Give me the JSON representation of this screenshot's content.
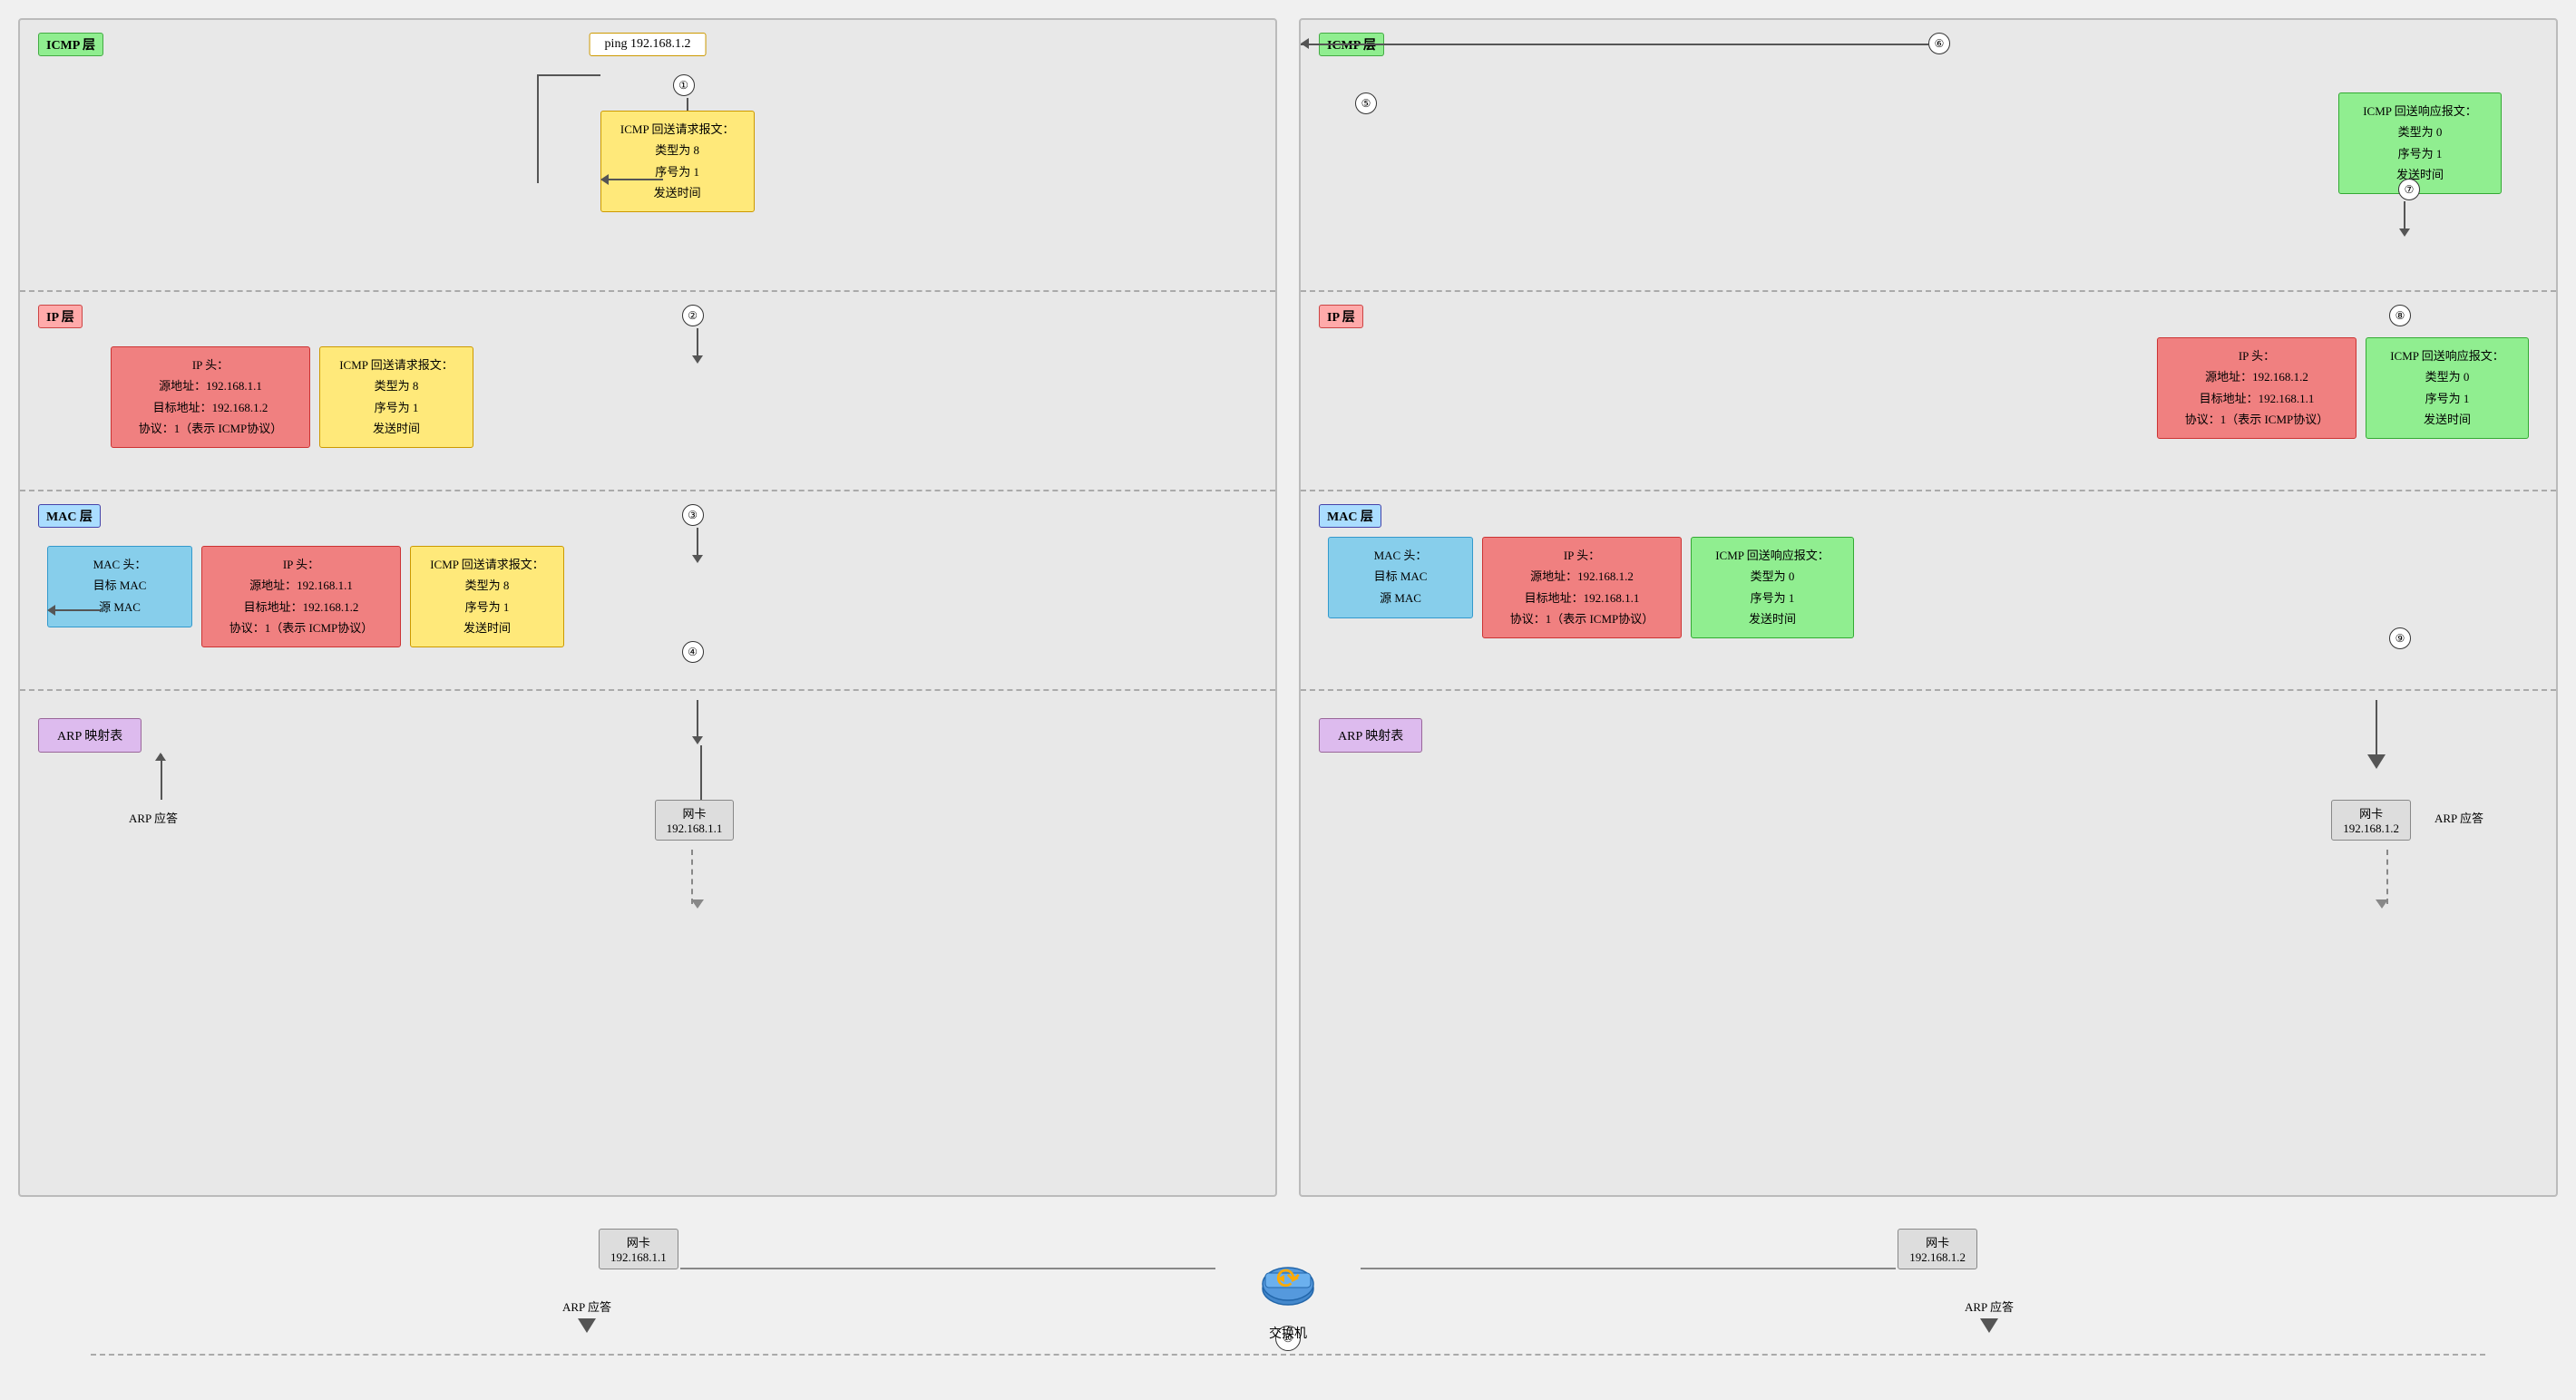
{
  "left_panel": {
    "ping_cmd": "ping 192.168.1.2",
    "icmp_layer_label": "ICMP 层",
    "ip_layer_label": "IP 层",
    "mac_layer_label": "MAC 层",
    "icmp_request_box": {
      "title": "ICMP 回送请求报文：",
      "line1": "类型为 8",
      "line2": "序号为 1",
      "line3": "发送时间"
    },
    "ip_header_box": {
      "title": "IP 头：",
      "line1": "源地址：192.168.1.1",
      "line2": "目标地址：192.168.1.2",
      "line3": "协议：1（表示 ICMP协议）"
    },
    "icmp_req_copy": {
      "title": "ICMP 回送请求报文：",
      "line1": "类型为 8",
      "line2": "序号为 1",
      "line3": "发送时间"
    },
    "mac_header_box": {
      "title": "MAC 头：",
      "line1": "目标 MAC",
      "line2": "源 MAC"
    },
    "ip_header_copy": {
      "title": "IP 头：",
      "line1": "源地址：192.168.1.1",
      "line2": "目标地址：192.168.1.2",
      "line3": "协议：1（表示 ICMP协议）"
    },
    "icmp_req_copy2": {
      "title": "ICMP 回送请求报文：",
      "line1": "类型为 8",
      "line2": "序号为 1",
      "line3": "发送时间"
    },
    "arp_table": "ARP 映射表",
    "arp_reply": "ARP 应答",
    "nic": "网卡\n192.168.1.1",
    "steps": {
      "s1": "①",
      "s2": "②",
      "s3": "③",
      "s4": "④"
    }
  },
  "right_panel": {
    "icmp_layer_label": "ICMP 层",
    "ip_layer_label": "IP 层",
    "mac_layer_label": "MAC 层",
    "icmp_response_box": {
      "title": "ICMP 回送响应报文：",
      "line1": "类型为 0",
      "line2": "序号为 1",
      "line3": "发送时间"
    },
    "ip_header_box": {
      "title": "IP 头：",
      "line1": "源地址：192.168.1.2",
      "line2": "目标地址：192.168.1.1",
      "line3": "协议：1（表示 ICMP协议）"
    },
    "icmp_resp_copy": {
      "title": "ICMP 回送响应报文：",
      "line1": "类型为 0",
      "line2": "序号为 1",
      "line3": "发送时间"
    },
    "mac_header_box": {
      "title": "MAC 头：",
      "line1": "目标 MAC",
      "line2": "源 MAC"
    },
    "ip_header_copy": {
      "title": "IP 头：",
      "line1": "源地址：192.168.1.2",
      "line2": "目标地址：192.168.1.1",
      "line3": "协议：1（表示 ICMP协议）"
    },
    "icmp_resp_copy2": {
      "title": "ICMP 回送响应报文：",
      "line1": "类型为 0",
      "line2": "序号为 1",
      "line3": "发送时间"
    },
    "arp_table": "ARP 映射表",
    "arp_reply": "ARP 应答",
    "nic": "网卡\n192.168.1.2",
    "steps": {
      "s5": "⑤",
      "s6": "⑥",
      "s7": "⑦",
      "s8": "⑧",
      "s9": "⑨"
    }
  },
  "switch_label": "交换机",
  "bottom_step": "⑩"
}
